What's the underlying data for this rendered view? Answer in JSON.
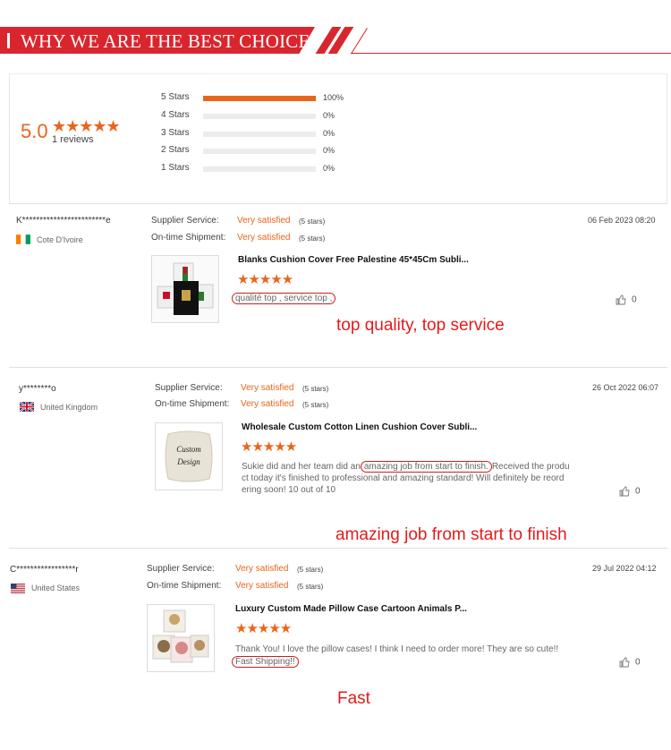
{
  "banner": {
    "title": "WHY WE ARE THE BEST CHOICE"
  },
  "summary": {
    "score": "5.0",
    "stars": "★★★★★",
    "review_count": "1 reviews",
    "distribution": [
      {
        "label": "5 Stars",
        "percent": "100%",
        "fraction": 1.0
      },
      {
        "label": "4 Stars",
        "percent": "0%",
        "fraction": 0
      },
      {
        "label": "3 Stars",
        "percent": "0%",
        "fraction": 0
      },
      {
        "label": "2 Stars",
        "percent": "0%",
        "fraction": 0
      },
      {
        "label": "1 Stars",
        "percent": "0%",
        "fraction": 0
      }
    ]
  },
  "reviews": [
    {
      "reviewer": "K************************e",
      "country": "Cote D'Ivoire",
      "supplier_label": "Supplier Service:",
      "supplier_value": "Very satisfied",
      "supplier_stars": "(5 stars)",
      "shipment_label": "On-time Shipment:",
      "shipment_value": "Very satisfied",
      "shipment_stars": "(5 stars)",
      "date": "06 Feb 2023 08:20",
      "product": "Blanks Cushion Cover Free Palestine 45*45Cm Subli...",
      "stars": "★★★★★",
      "comment_highlight": "qualité top , service top ,",
      "likes": "0",
      "annotation": "top quality, top service"
    },
    {
      "reviewer": "y********o",
      "country": "United Kingdom",
      "supplier_label": "Supplier Service:",
      "supplier_value": "Very satisfied",
      "supplier_stars": "(5 stars)",
      "shipment_label": "On-time Shipment:",
      "shipment_value": "Very satisfied",
      "shipment_stars": "(5 stars)",
      "date": "26 Oct 2022 06:07",
      "product": "Wholesale Custom Cotton Linen Cushion Cover Subli...",
      "stars": "★★★★★",
      "comment_pre": "Sukie did and her team did an",
      "comment_highlight": "amazing job from start to finish.",
      "comment_post": "Received the produ",
      "comment_line2": "ct today it's finished to professional and amazing standard! Will definitely be reord",
      "comment_line3": "ering soon! 10 out of 10",
      "thumb_text1": "Custom",
      "thumb_text2": "Design",
      "likes": "0",
      "annotation": "amazing job from start to finish"
    },
    {
      "reviewer": "C*****************r",
      "country": "United States",
      "supplier_label": "Supplier Service:",
      "supplier_value": "Very satisfied",
      "supplier_stars": "(5 stars)",
      "shipment_label": "On-time Shipment:",
      "shipment_value": "Very satisfied",
      "shipment_stars": "(5 stars)",
      "date": "29 Jul 2022 04:12",
      "product": "Luxury Custom Made Pillow Case Cartoon Animals P...",
      "stars": "★★★★★",
      "comment_line1": "Thank You! I love the pillow cases! I think I need to order more! They are so cute!!",
      "comment_highlight": "Fast Shipping!!",
      "likes": "0",
      "annotation": "Fast"
    }
  ],
  "colors": {
    "brand_red": "#d9262e",
    "accent_orange": "#e9651b",
    "annotation_red": "#e21b1b"
  }
}
